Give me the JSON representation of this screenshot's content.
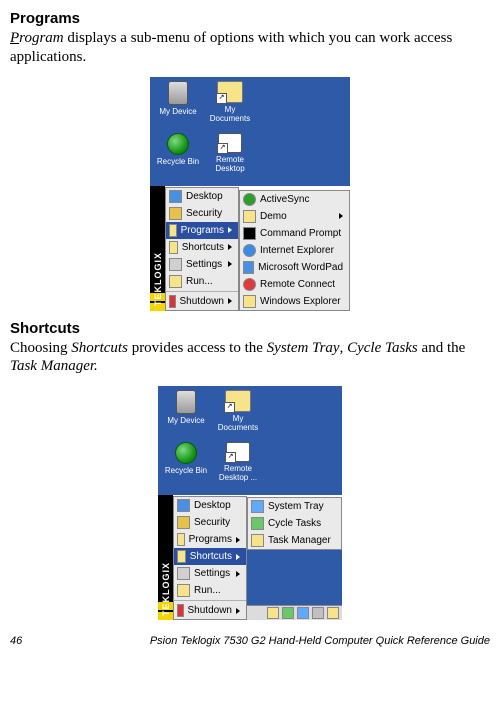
{
  "section1": {
    "heading": "Programs",
    "para_plain_before": "",
    "para_italic_word": "Program",
    "para_after": " displays a sub-menu of options with which you can work access applications."
  },
  "section2": {
    "heading": "Shortcuts",
    "sentence_parts": {
      "a": "Choosing ",
      "b": "Shortcuts",
      "c": " provides access to the ",
      "d": "System Tray",
      "e": ", ",
      "f": "Cycle Tasks",
      "g": " and the ",
      "h": "Task Manager.",
      "i": ""
    }
  },
  "desktop_icons": {
    "my_device": "My Device",
    "my_documents": "My Documents",
    "recycle_bin": "Recycle Bin",
    "remote_desktop": "Remote Desktop",
    "remote_desktop_ell": "Remote Desktop ..."
  },
  "brand": "TEKLOGIX",
  "start_menu": {
    "desktop": "Desktop",
    "security": "Security",
    "programs": "Programs",
    "shortcuts": "Shortcuts",
    "settings": "Settings",
    "run": "Run...",
    "shutdown": "Shutdown"
  },
  "programs_submenu": {
    "activesync": "ActiveSync",
    "demo": "Demo",
    "command_prompt": "Command Prompt",
    "internet_explorer": "Internet Explorer",
    "microsoft_wordpad": "Microsoft WordPad",
    "remote_connect": "Remote Connect",
    "windows_explorer": "Windows Explorer"
  },
  "shortcuts_submenu": {
    "system_tray": "System Tray",
    "cycle_tasks": "Cycle Tasks",
    "task_manager": "Task Manager"
  },
  "footer": {
    "page": "46",
    "title": "Psion Teklogix 7530 G2 Hand-Held Computer Quick Reference Guide"
  }
}
